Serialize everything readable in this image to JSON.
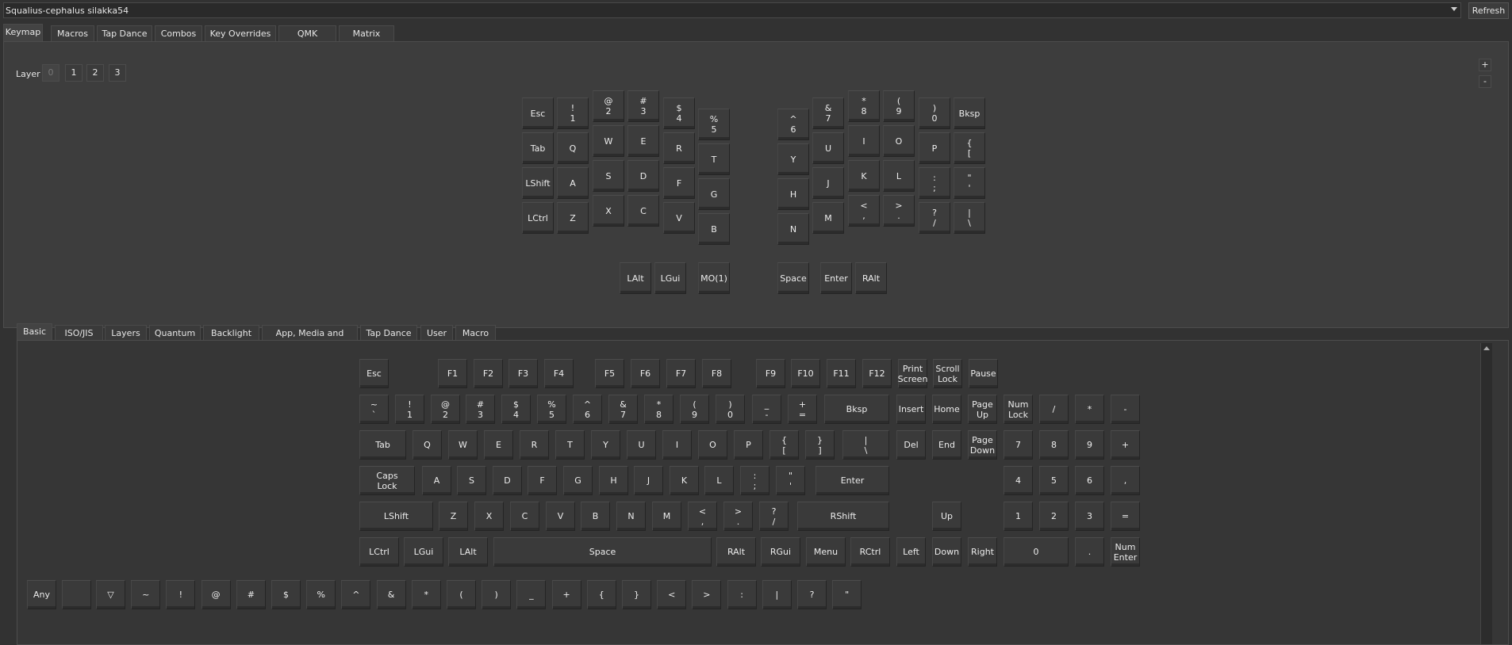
{
  "device": {
    "name": "Squalius-cephalus silakka54",
    "refresh_label": "Refresh"
  },
  "main_tabs": [
    "Keymap",
    "Macros",
    "Tap Dance",
    "Combos",
    "Key Overrides",
    "QMK Settings",
    "Matrix tester"
  ],
  "layer": {
    "label": "Layer",
    "options": [
      "0",
      "1",
      "2",
      "3"
    ],
    "selected": "0",
    "add_label": "+",
    "remove_label": "-"
  },
  "keymap_keys": [
    {
      "label": "Esc"
    },
    {
      "label": "!\n1"
    },
    {
      "label": "@\n2"
    },
    {
      "label": "#\n3"
    },
    {
      "label": "$\n4"
    },
    {
      "label": "%\n5"
    },
    {
      "label": "Tab"
    },
    {
      "label": "Q"
    },
    {
      "label": "W"
    },
    {
      "label": "E"
    },
    {
      "label": "R"
    },
    {
      "label": "T"
    },
    {
      "label": "LShift"
    },
    {
      "label": "A"
    },
    {
      "label": "S"
    },
    {
      "label": "D"
    },
    {
      "label": "F"
    },
    {
      "label": "G"
    },
    {
      "label": "LCtrl"
    },
    {
      "label": "Z"
    },
    {
      "label": "X"
    },
    {
      "label": "C"
    },
    {
      "label": "V"
    },
    {
      "label": "B"
    },
    {
      "label": "LAlt"
    },
    {
      "label": "LGui"
    },
    {
      "label": "MO(1)"
    },
    {
      "label": "^\n6"
    },
    {
      "label": "&\n7"
    },
    {
      "label": "*\n8"
    },
    {
      "label": "(\n9"
    },
    {
      "label": ")\n0"
    },
    {
      "label": "Bksp"
    },
    {
      "label": "Y"
    },
    {
      "label": "U"
    },
    {
      "label": "I"
    },
    {
      "label": "O"
    },
    {
      "label": "P"
    },
    {
      "label": "{\n["
    },
    {
      "label": "H"
    },
    {
      "label": "J"
    },
    {
      "label": "K"
    },
    {
      "label": "L"
    },
    {
      "label": ":\n;"
    },
    {
      "label": "\"\n'"
    },
    {
      "label": "N"
    },
    {
      "label": "M"
    },
    {
      "label": "<\n,"
    },
    {
      "label": ">\n."
    },
    {
      "label": "?\n/"
    },
    {
      "label": "|\n\\"
    },
    {
      "label": "Space"
    },
    {
      "label": "Enter"
    },
    {
      "label": "RAlt"
    }
  ],
  "basic_tabs": [
    "Basic",
    "ISO/JIS",
    "Layers",
    "Quantum",
    "Backlight",
    "App, Media and Mouse",
    "Tap Dance",
    "User",
    "Macro"
  ],
  "basic_keys": [
    {
      "label": "Esc"
    },
    {
      "label": "F1"
    },
    {
      "label": "F2"
    },
    {
      "label": "F3"
    },
    {
      "label": "F4"
    },
    {
      "label": "F5"
    },
    {
      "label": "F6"
    },
    {
      "label": "F7"
    },
    {
      "label": "F8"
    },
    {
      "label": "F9"
    },
    {
      "label": "F10"
    },
    {
      "label": "F11"
    },
    {
      "label": "F12"
    },
    {
      "label": "Print\nScreen"
    },
    {
      "label": "Scroll\nLock"
    },
    {
      "label": "Pause"
    },
    {
      "label": "~\n`"
    },
    {
      "label": "!\n1"
    },
    {
      "label": "@\n2"
    },
    {
      "label": "#\n3"
    },
    {
      "label": "$\n4"
    },
    {
      "label": "%\n5"
    },
    {
      "label": "^\n6"
    },
    {
      "label": "&\n7"
    },
    {
      "label": "*\n8"
    },
    {
      "label": "(\n9"
    },
    {
      "label": ")\n0"
    },
    {
      "label": "_\n-"
    },
    {
      "label": "+\n="
    },
    {
      "label": "Bksp"
    },
    {
      "label": "Insert"
    },
    {
      "label": "Home"
    },
    {
      "label": "Page\nUp"
    },
    {
      "label": "Num\nLock"
    },
    {
      "label": "/"
    },
    {
      "label": "*"
    },
    {
      "label": "-"
    },
    {
      "label": "Tab"
    },
    {
      "label": "Q"
    },
    {
      "label": "W"
    },
    {
      "label": "E"
    },
    {
      "label": "R"
    },
    {
      "label": "T"
    },
    {
      "label": "Y"
    },
    {
      "label": "U"
    },
    {
      "label": "I"
    },
    {
      "label": "O"
    },
    {
      "label": "P"
    },
    {
      "label": "{\n["
    },
    {
      "label": "}\n]"
    },
    {
      "label": "|\n\\"
    },
    {
      "label": "Del"
    },
    {
      "label": "End"
    },
    {
      "label": "Page\nDown"
    },
    {
      "label": "7"
    },
    {
      "label": "8"
    },
    {
      "label": "9"
    },
    {
      "label": "+"
    },
    {
      "label": "Caps\nLock"
    },
    {
      "label": "A"
    },
    {
      "label": "S"
    },
    {
      "label": "D"
    },
    {
      "label": "F"
    },
    {
      "label": "G"
    },
    {
      "label": "H"
    },
    {
      "label": "J"
    },
    {
      "label": "K"
    },
    {
      "label": "L"
    },
    {
      "label": ":\n;"
    },
    {
      "label": "\"\n'"
    },
    {
      "label": "Enter"
    },
    {
      "label": "4"
    },
    {
      "label": "5"
    },
    {
      "label": "6"
    },
    {
      "label": ","
    },
    {
      "label": "LShift"
    },
    {
      "label": "Z"
    },
    {
      "label": "X"
    },
    {
      "label": "C"
    },
    {
      "label": "V"
    },
    {
      "label": "B"
    },
    {
      "label": "N"
    },
    {
      "label": "M"
    },
    {
      "label": "<\n,"
    },
    {
      "label": ">\n."
    },
    {
      "label": "?\n/"
    },
    {
      "label": "RShift"
    },
    {
      "label": "Up"
    },
    {
      "label": "1"
    },
    {
      "label": "2"
    },
    {
      "label": "3"
    },
    {
      "label": "="
    },
    {
      "label": "LCtrl"
    },
    {
      "label": "LGui"
    },
    {
      "label": "LAlt"
    },
    {
      "label": "Space"
    },
    {
      "label": "RAlt"
    },
    {
      "label": "RGui"
    },
    {
      "label": "Menu"
    },
    {
      "label": "RCtrl"
    },
    {
      "label": "Left"
    },
    {
      "label": "Down"
    },
    {
      "label": "Right"
    },
    {
      "label": "0"
    },
    {
      "label": "."
    },
    {
      "label": "Num\nEnter"
    }
  ],
  "special_keys": [
    {
      "label": "Any"
    },
    {
      "label": ""
    },
    {
      "label": "▽"
    },
    {
      "label": "~"
    },
    {
      "label": "!"
    },
    {
      "label": "@"
    },
    {
      "label": "#"
    },
    {
      "label": "$"
    },
    {
      "label": "%"
    },
    {
      "label": "^"
    },
    {
      "label": "&"
    },
    {
      "label": "*"
    },
    {
      "label": "("
    },
    {
      "label": ")"
    },
    {
      "label": "_"
    },
    {
      "label": "+"
    },
    {
      "label": "{"
    },
    {
      "label": "}"
    },
    {
      "label": "<"
    },
    {
      "label": ">"
    },
    {
      "label": ":"
    },
    {
      "label": "|"
    },
    {
      "label": "?"
    },
    {
      "label": "\""
    }
  ]
}
